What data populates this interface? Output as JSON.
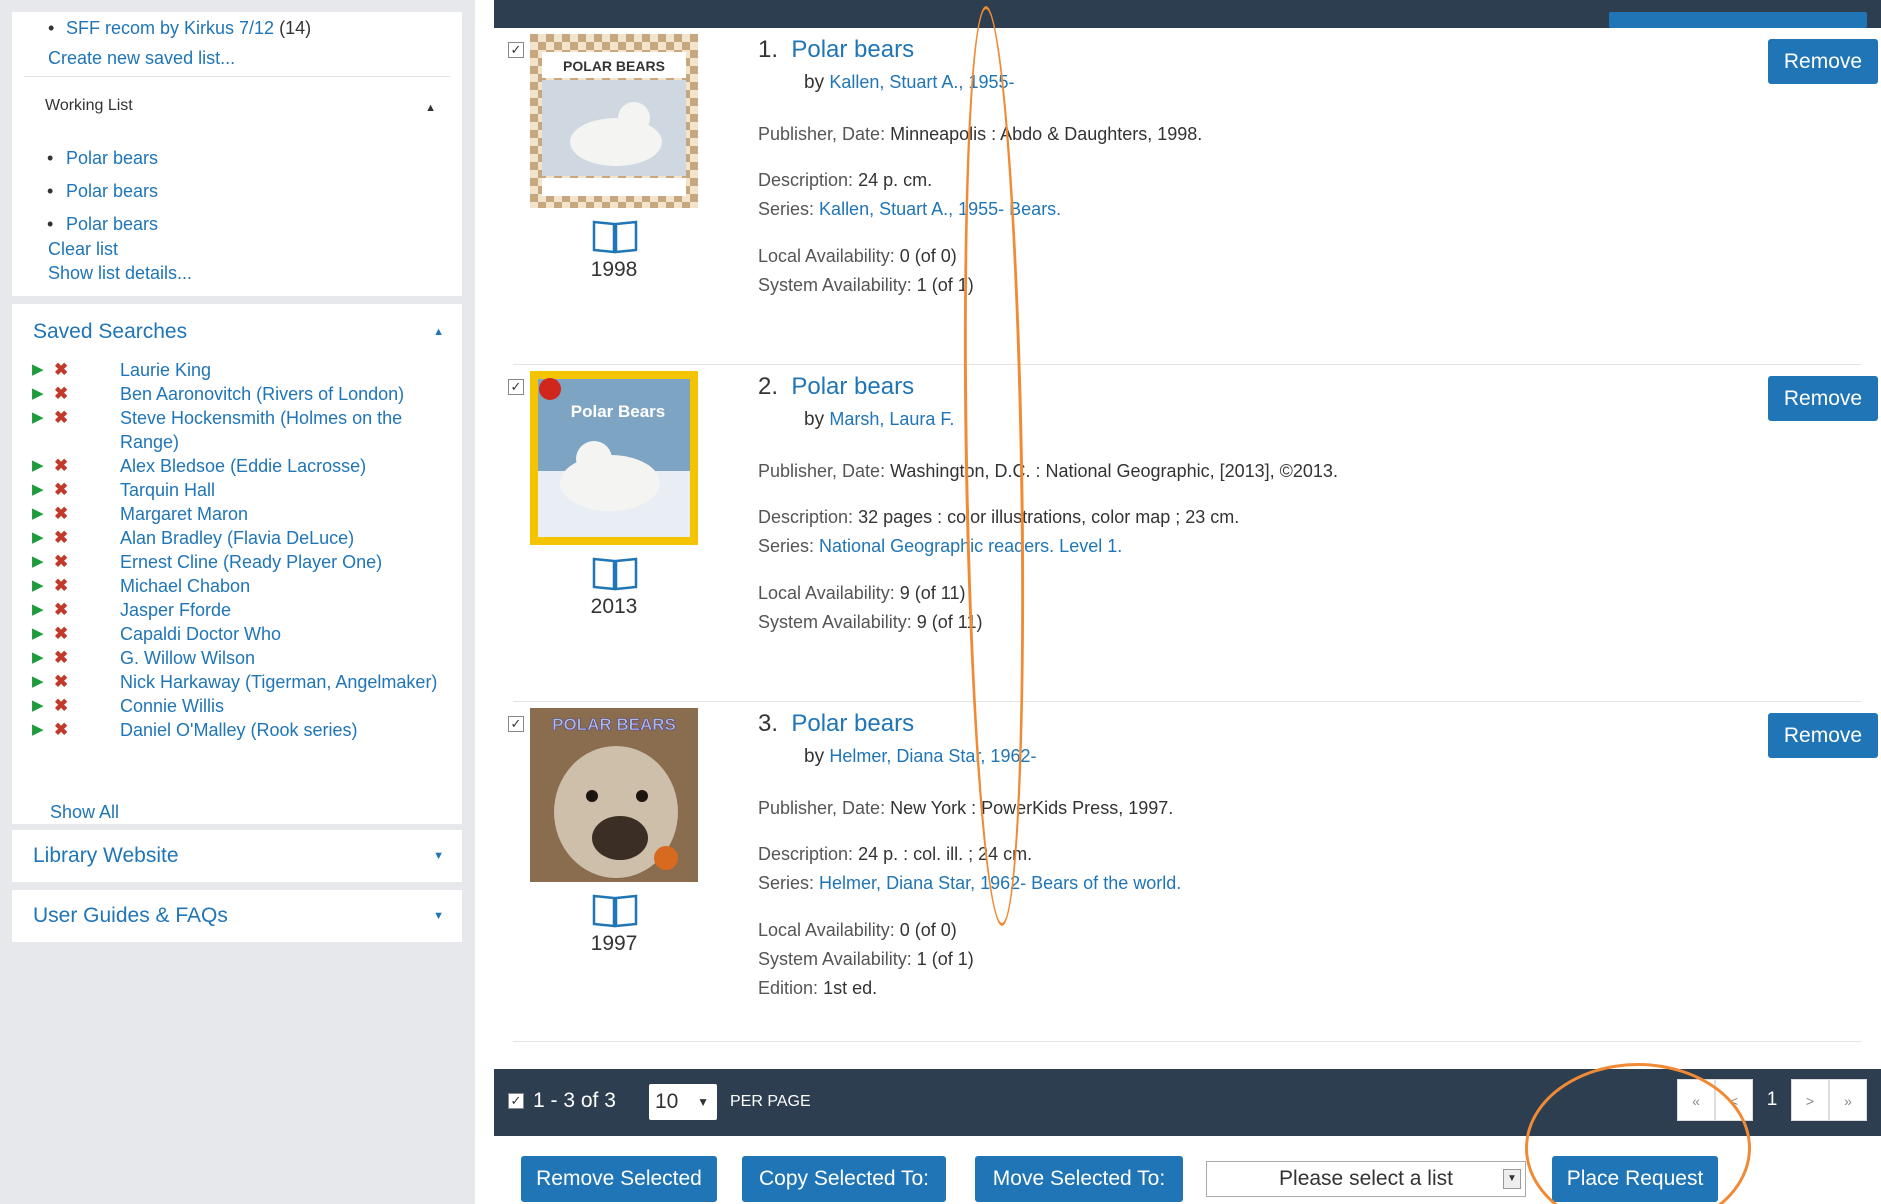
{
  "sidebar": {
    "saved_lists": {
      "sff_item": "SFF recom by Kirkus 7/12",
      "sff_count": "(14)",
      "create_link": "Create new saved list..."
    },
    "working_list": {
      "heading": "Working List",
      "items": [
        "Polar bears",
        "Polar bears",
        "Polar bears"
      ],
      "clear_link": "Clear list",
      "details_link": "Show list details..."
    },
    "saved_searches": {
      "heading": "Saved Searches",
      "items": [
        "Laurie King",
        "Ben Aaronovitch (Rivers of London)",
        "Steve Hockensmith (Holmes on the Range)",
        "Alex Bledsoe (Eddie Lacrosse)",
        "Tarquin Hall",
        "Margaret Maron",
        "Alan Bradley (Flavia DeLuce)",
        "Ernest Cline (Ready Player One)",
        "Michael Chabon",
        "Jasper Fforde",
        "Capaldi Doctor Who",
        "G. Willow Wilson",
        "Nick Harkaway (Tigerman, Angelmaker)",
        "Connie Willis",
        "Daniel O'Malley (Rook series)"
      ],
      "show_all": "Show All"
    },
    "library_website": "Library Website",
    "user_guides": "User Guides & FAQs"
  },
  "records": [
    {
      "number": "1.",
      "title": "Polar bears",
      "by_label": "by",
      "author": "Kallen, Stuart A., 1955-",
      "year": "1998",
      "cover_text": "POLAR BEARS",
      "publisher_label": "Publisher, Date:",
      "publisher": "Minneapolis : Abdo & Daughters, 1998.",
      "description_label": "Description:",
      "description": "24 p. cm.",
      "series_label": "Series:",
      "series": "Kallen, Stuart A., 1955- Bears.",
      "local_label": "Local Availability:",
      "local": "0 (of 0)",
      "system_label": "System Availability:",
      "system": "1 (of 1)",
      "remove": "Remove"
    },
    {
      "number": "2.",
      "title": "Polar bears",
      "by_label": "by",
      "author": "Marsh, Laura F.",
      "year": "2013",
      "cover_text": "Polar Bears",
      "publisher_label": "Publisher, Date:",
      "publisher": "Washington, D.C. : National Geographic, [2013], ©2013.",
      "description_label": "Description:",
      "description": "32 pages : color illustrations, color map ; 23 cm.",
      "series_label": "Series:",
      "series": "National Geographic readers. Level 1.",
      "local_label": "Local Availability:",
      "local": "9 (of 11)",
      "system_label": "System Availability:",
      "system": "9 (of 11)",
      "remove": "Remove"
    },
    {
      "number": "3.",
      "title": "Polar bears",
      "by_label": "by",
      "author": "Helmer, Diana Star, 1962-",
      "year": "1997",
      "cover_text": "POLAR BEARS",
      "publisher_label": "Publisher, Date:",
      "publisher": "New York : PowerKids Press, 1997.",
      "description_label": "Description:",
      "description": "24 p. : col. ill. ; 24 cm.",
      "series_label": "Series:",
      "series": "Helmer, Diana Star, 1962- Bears of the world.",
      "local_label": "Local Availability:",
      "local": "0 (of 0)",
      "system_label": "System Availability:",
      "system": "1 (of 1)",
      "edition_label": "Edition:",
      "edition": "1st ed.",
      "remove": "Remove"
    }
  ],
  "pagination": {
    "range": "1 - 3 of 3",
    "per_page_value": "10",
    "per_page_label": "PER PAGE",
    "first": "«",
    "prev": "<",
    "current": "1",
    "next": ">",
    "last": "»"
  },
  "actions": {
    "remove_selected": "Remove Selected",
    "copy_selected": "Copy Selected To:",
    "move_selected": "Move Selected To:",
    "list_placeholder": "Please select a list",
    "place_request": "Place Request"
  },
  "colors": {
    "link": "#1f75b6",
    "dark_bar": "#2c3e50",
    "annotation": "#f08a34",
    "play": "#1e9a3b",
    "delete": "#c0392b"
  }
}
